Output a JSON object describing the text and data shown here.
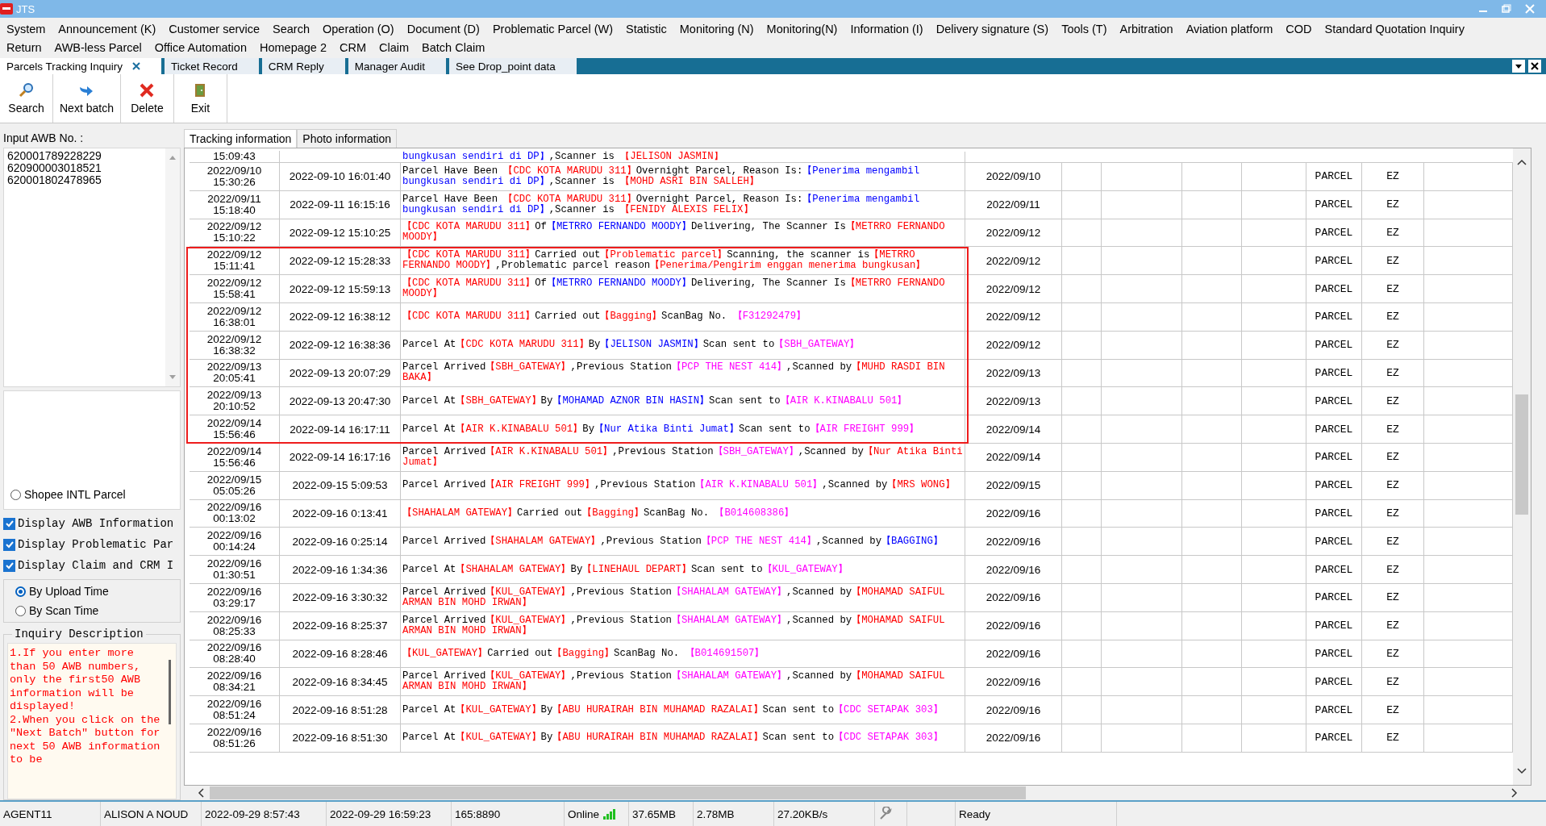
{
  "window": {
    "title": "JTS"
  },
  "menu_rows": [
    [
      "System",
      "Announcement (K)",
      "Customer service",
      "Search",
      "Operation (O)",
      "Document (D)",
      "Problematic Parcel (W)",
      "Statistic",
      "Monitoring (N)",
      "Monitoring(N)",
      "Information (I)",
      "Delivery signature (S)",
      "Tools (T)",
      "Arbitration",
      "Aviation platform",
      "COD",
      "Standard Quotation Inquiry"
    ],
    [
      "Return",
      "AWB-less Parcel",
      "Office Automation",
      "Homepage 2",
      "CRM",
      "Claim",
      "Batch Claim"
    ]
  ],
  "tabs": [
    {
      "label": "Parcels Tracking Inquiry",
      "selected": true,
      "closable": true
    },
    {
      "label": "Ticket Record",
      "selected": false,
      "closable": false
    },
    {
      "label": "CRM Reply",
      "selected": false,
      "closable": false
    },
    {
      "label": "Manager Audit",
      "selected": false,
      "closable": false
    },
    {
      "label": "See Drop_point data",
      "selected": false,
      "closable": false
    }
  ],
  "toolbar": [
    {
      "label": "Search",
      "kind": "search"
    },
    {
      "label": "Next batch",
      "kind": "next"
    },
    {
      "label": "Delete",
      "kind": "delete"
    },
    {
      "label": "Exit",
      "kind": "exit"
    }
  ],
  "awb_input": {
    "label": "Input AWB No. :",
    "lines": [
      "620001789228229",
      "620900003018521",
      "620001802478965"
    ]
  },
  "shopee_option": {
    "label": "Shopee INTL Parcel",
    "selected": false
  },
  "display_options": [
    {
      "label": "Display AWB Information",
      "checked": true
    },
    {
      "label": "Display Problematic Par",
      "checked": true
    },
    {
      "label": "Display Claim and CRM I",
      "checked": true
    }
  ],
  "time_basis": [
    {
      "label": "By Upload Time",
      "selected": true
    },
    {
      "label": "By Scan Time",
      "selected": false
    }
  ],
  "inquiry": {
    "title": "Inquiry Description",
    "paragraphs": [
      "1.If you enter more than  50  AWB numbers, only the first50  AWB information will be displayed!",
      "2.When you click on the ″Next Batch″ button for next  50 AWB information to be"
    ]
  },
  "content_tabs": [
    {
      "label": "Tracking information",
      "selected": true
    },
    {
      "label": "Photo information",
      "selected": false
    }
  ],
  "tracking_rows": [
    {
      "upload_time": "15:09:43",
      "segments": [
        {
          "text": "bungkusan sendiri di DP】",
          "color": "#0000ff"
        },
        {
          "text": ",Scanner is ",
          "color": "#000000"
        },
        {
          "text": "【JELISON JASMIN】",
          "color": "#ff0000"
        }
      ],
      "highlighted": false
    },
    {
      "upload_time": "2022/09/10 15:30:26",
      "scan_time": "2022-09-10 16:01:40",
      "segments": [
        {
          "text": "Parcel Have Been ",
          "color": "#000000"
        },
        {
          "text": "【CDC KOTA MARUDU 311】",
          "color": "#ff0000"
        },
        {
          "text": "Overnight Parcel, Reason Is:",
          "color": "#000000"
        },
        {
          "text": "【Penerima mengambil bungkusan sendiri di DP】",
          "color": "#0000ff"
        },
        {
          "text": ",Scanner is ",
          "color": "#000000"
        },
        {
          "text": "【MOHD ASRI BIN SALLEH】",
          "color": "#ff0000"
        }
      ],
      "date": "2022/09/10",
      "type": "PARCEL",
      "code": "EZ",
      "highlighted": false
    },
    {
      "upload_time": "2022/09/11 15:18:40",
      "scan_time": "2022-09-11 16:15:16",
      "segments": [
        {
          "text": "Parcel Have Been ",
          "color": "#000000"
        },
        {
          "text": "【CDC KOTA MARUDU 311】",
          "color": "#ff0000"
        },
        {
          "text": "Overnight Parcel, Reason Is:",
          "color": "#000000"
        },
        {
          "text": "【Penerima mengambil bungkusan sendiri di DP】",
          "color": "#0000ff"
        },
        {
          "text": ",Scanner is ",
          "color": "#000000"
        },
        {
          "text": "【FENIDY ALEXIS FELIX】",
          "color": "#ff0000"
        }
      ],
      "date": "2022/09/11",
      "type": "PARCEL",
      "code": "EZ",
      "highlighted": false
    },
    {
      "upload_time": "2022/09/12 15:10:22",
      "scan_time": "2022-09-12 15:10:25",
      "segments": [
        {
          "text": "【CDC KOTA MARUDU 311】",
          "color": "#ff0000"
        },
        {
          "text": "Of",
          "color": "#000000"
        },
        {
          "text": "【METRRO FERNANDO MOODY】",
          "color": "#0000ff"
        },
        {
          "text": "Delivering, The Scanner Is",
          "color": "#000000"
        },
        {
          "text": "【METRRO FERNANDO MOODY】",
          "color": "#ff0000"
        }
      ],
      "date": "2022/09/12",
      "type": "PARCEL",
      "code": "EZ",
      "highlighted": false
    },
    {
      "upload_time": "2022/09/12 15:11:41",
      "scan_time": "2022-09-12 15:28:33",
      "segments": [
        {
          "text": "【CDC KOTA MARUDU 311】",
          "color": "#ff0000"
        },
        {
          "text": "Carried out",
          "color": "#000000"
        },
        {
          "text": "【Problematic parcel】",
          "color": "#ff0000"
        },
        {
          "text": "Scanning, the scanner is",
          "color": "#000000"
        },
        {
          "text": "【METRRO FERNANDO MOODY】",
          "color": "#ff0000"
        },
        {
          "text": ",Problematic parcel reason",
          "color": "#000000"
        },
        {
          "text": "【Penerima/Pengirim enggan menerima bungkusan】",
          "color": "#ff0000"
        }
      ],
      "date": "2022/09/12",
      "type": "PARCEL",
      "code": "EZ",
      "highlighted": true
    },
    {
      "upload_time": "2022/09/12 15:58:41",
      "scan_time": "2022-09-12 15:59:13",
      "segments": [
        {
          "text": "【CDC KOTA MARUDU 311】",
          "color": "#ff0000"
        },
        {
          "text": "Of",
          "color": "#000000"
        },
        {
          "text": "【METRRO FERNANDO MOODY】",
          "color": "#0000ff"
        },
        {
          "text": "Delivering, The Scanner Is",
          "color": "#000000"
        },
        {
          "text": "【METRRO FERNANDO MOODY】",
          "color": "#ff0000"
        }
      ],
      "date": "2022/09/12",
      "type": "PARCEL",
      "code": "EZ",
      "highlighted": true
    },
    {
      "upload_time": "2022/09/12 16:38:01",
      "scan_time": "2022-09-12 16:38:12",
      "segments": [
        {
          "text": "【CDC KOTA MARUDU 311】",
          "color": "#ff0000"
        },
        {
          "text": "Carried out",
          "color": "#000000"
        },
        {
          "text": "【Bagging】",
          "color": "#ff0000"
        },
        {
          "text": "ScanBag No. ",
          "color": "#000000"
        },
        {
          "text": "【F31292479】",
          "color": "#ff00ff"
        }
      ],
      "date": "2022/09/12",
      "type": "PARCEL",
      "code": "EZ",
      "highlighted": true
    },
    {
      "upload_time": "2022/09/12 16:38:32",
      "scan_time": "2022-09-12 16:38:36",
      "segments": [
        {
          "text": "Parcel At",
          "color": "#000000"
        },
        {
          "text": "【CDC KOTA MARUDU 311】",
          "color": "#ff0000"
        },
        {
          "text": "By",
          "color": "#000000"
        },
        {
          "text": "【JELISON JASMIN】",
          "color": "#0000ff"
        },
        {
          "text": "Scan sent to",
          "color": "#000000"
        },
        {
          "text": "【SBH_GATEWAY】",
          "color": "#ff00ff"
        }
      ],
      "date": "2022/09/12",
      "type": "PARCEL",
      "code": "EZ",
      "highlighted": true
    },
    {
      "upload_time": "2022/09/13 20:05:41",
      "scan_time": "2022-09-13 20:07:29",
      "segments": [
        {
          "text": "Parcel Arrived",
          "color": "#000000"
        },
        {
          "text": "【SBH_GATEWAY】",
          "color": "#ff0000"
        },
        {
          "text": ",Previous Station",
          "color": "#000000"
        },
        {
          "text": "【PCP THE NEST 414】",
          "color": "#ff00ff"
        },
        {
          "text": ",Scanned by",
          "color": "#000000"
        },
        {
          "text": "【MUHD RASDI BIN BAKA】",
          "color": "#ff0000"
        }
      ],
      "date": "2022/09/13",
      "type": "PARCEL",
      "code": "EZ",
      "highlighted": true
    },
    {
      "upload_time": "2022/09/13 20:10:52",
      "scan_time": "2022-09-13 20:47:30",
      "segments": [
        {
          "text": "Parcel At",
          "color": "#000000"
        },
        {
          "text": "【SBH_GATEWAY】",
          "color": "#ff0000"
        },
        {
          "text": "By",
          "color": "#000000"
        },
        {
          "text": "【MOHAMAD AZNOR BIN HASIN】",
          "color": "#0000ff"
        },
        {
          "text": "Scan sent to",
          "color": "#000000"
        },
        {
          "text": "【AIR K.KINABALU 501】",
          "color": "#ff00ff"
        }
      ],
      "date": "2022/09/13",
      "type": "PARCEL",
      "code": "EZ",
      "highlighted": true
    },
    {
      "upload_time": "2022/09/14 15:56:46",
      "scan_time": "2022-09-14 16:17:11",
      "segments": [
        {
          "text": "Parcel At",
          "color": "#000000"
        },
        {
          "text": "【AIR K.KINABALU 501】",
          "color": "#ff0000"
        },
        {
          "text": "By",
          "color": "#000000"
        },
        {
          "text": "【Nur Atika Binti Jumat】",
          "color": "#0000ff"
        },
        {
          "text": "Scan sent to",
          "color": "#000000"
        },
        {
          "text": "【AIR FREIGHT 999】",
          "color": "#ff00ff"
        }
      ],
      "date": "2022/09/14",
      "type": "PARCEL",
      "code": "EZ",
      "highlighted": true
    },
    {
      "upload_time": "2022/09/14 15:56:46",
      "scan_time": "2022-09-14 16:17:16",
      "segments": [
        {
          "text": "Parcel Arrived",
          "color": "#000000"
        },
        {
          "text": "【AIR K.KINABALU 501】",
          "color": "#ff0000"
        },
        {
          "text": ",Previous Station",
          "color": "#000000"
        },
        {
          "text": "【SBH_GATEWAY】",
          "color": "#ff00ff"
        },
        {
          "text": ",Scanned by",
          "color": "#000000"
        },
        {
          "text": "【Nur Atika Binti Jumat】",
          "color": "#ff0000"
        }
      ],
      "date": "2022/09/14",
      "type": "PARCEL",
      "code": "EZ",
      "highlighted": false
    },
    {
      "upload_time": "2022/09/15 05:05:26",
      "scan_time": "2022-09-15 5:09:53",
      "segments": [
        {
          "text": "Parcel Arrived",
          "color": "#000000"
        },
        {
          "text": "【AIR FREIGHT 999】",
          "color": "#ff0000"
        },
        {
          "text": ",Previous Station",
          "color": "#000000"
        },
        {
          "text": "【AIR K.KINABALU 501】",
          "color": "#ff00ff"
        },
        {
          "text": ",Scanned by",
          "color": "#000000"
        },
        {
          "text": "【MRS WONG】",
          "color": "#ff0000"
        }
      ],
      "date": "2022/09/15",
      "type": "PARCEL",
      "code": "EZ",
      "highlighted": false
    },
    {
      "upload_time": "2022/09/16 00:13:02",
      "scan_time": "2022-09-16 0:13:41",
      "segments": [
        {
          "text": "【SHAHALAM GATEWAY】",
          "color": "#ff0000"
        },
        {
          "text": "Carried out",
          "color": "#000000"
        },
        {
          "text": "【Bagging】",
          "color": "#ff0000"
        },
        {
          "text": "ScanBag No. ",
          "color": "#000000"
        },
        {
          "text": "【B014608386】",
          "color": "#ff00ff"
        }
      ],
      "date": "2022/09/16",
      "type": "PARCEL",
      "code": "EZ",
      "highlighted": false
    },
    {
      "upload_time": "2022/09/16 00:14:24",
      "scan_time": "2022-09-16 0:25:14",
      "segments": [
        {
          "text": "Parcel Arrived",
          "color": "#000000"
        },
        {
          "text": "【SHAHALAM GATEWAY】",
          "color": "#ff0000"
        },
        {
          "text": ",Previous Station",
          "color": "#000000"
        },
        {
          "text": "【PCP THE NEST 414】",
          "color": "#ff00ff"
        },
        {
          "text": ",Scanned by",
          "color": "#000000"
        },
        {
          "text": "【BAGGING】",
          "color": "#0000ff"
        }
      ],
      "date": "2022/09/16",
      "type": "PARCEL",
      "code": "EZ",
      "highlighted": false
    },
    {
      "upload_time": "2022/09/16 01:30:51",
      "scan_time": "2022-09-16 1:34:36",
      "segments": [
        {
          "text": "Parcel At",
          "color": "#000000"
        },
        {
          "text": "【SHAHALAM GATEWAY】",
          "color": "#ff0000"
        },
        {
          "text": "By",
          "color": "#000000"
        },
        {
          "text": "【LINEHAUL DEPART】",
          "color": "#ff0000"
        },
        {
          "text": "Scan sent to",
          "color": "#000000"
        },
        {
          "text": "【KUL_GATEWAY】",
          "color": "#ff00ff"
        }
      ],
      "date": "2022/09/16",
      "type": "PARCEL",
      "code": "EZ",
      "highlighted": false
    },
    {
      "upload_time": "2022/09/16 03:29:17",
      "scan_time": "2022-09-16 3:30:32",
      "segments": [
        {
          "text": "Parcel Arrived",
          "color": "#000000"
        },
        {
          "text": "【KUL_GATEWAY】",
          "color": "#ff0000"
        },
        {
          "text": ",Previous Station",
          "color": "#000000"
        },
        {
          "text": "【SHAHALAM GATEWAY】",
          "color": "#ff00ff"
        },
        {
          "text": ",Scanned by",
          "color": "#000000"
        },
        {
          "text": "【MOHAMAD SAIFUL ARMAN BIN MOHD IRWAN】",
          "color": "#ff0000"
        }
      ],
      "date": "2022/09/16",
      "type": "PARCEL",
      "code": "EZ",
      "highlighted": false
    },
    {
      "upload_time": "2022/09/16 08:25:33",
      "scan_time": "2022-09-16 8:25:37",
      "segments": [
        {
          "text": "Parcel Arrived",
          "color": "#000000"
        },
        {
          "text": "【KUL_GATEWAY】",
          "color": "#ff0000"
        },
        {
          "text": ",Previous Station",
          "color": "#000000"
        },
        {
          "text": "【SHAHALAM GATEWAY】",
          "color": "#ff00ff"
        },
        {
          "text": ",Scanned by",
          "color": "#000000"
        },
        {
          "text": "【MOHAMAD SAIFUL ARMAN BIN MOHD IRWAN】",
          "color": "#ff0000"
        }
      ],
      "date": "2022/09/16",
      "type": "PARCEL",
      "code": "EZ",
      "highlighted": false
    },
    {
      "upload_time": "2022/09/16 08:28:40",
      "scan_time": "2022-09-16 8:28:46",
      "segments": [
        {
          "text": "【KUL_GATEWAY】",
          "color": "#ff0000"
        },
        {
          "text": "Carried out",
          "color": "#000000"
        },
        {
          "text": "【Bagging】",
          "color": "#ff0000"
        },
        {
          "text": "ScanBag No. ",
          "color": "#000000"
        },
        {
          "text": "【B014691507】",
          "color": "#ff00ff"
        }
      ],
      "date": "2022/09/16",
      "type": "PARCEL",
      "code": "EZ",
      "highlighted": false
    },
    {
      "upload_time": "2022/09/16 08:34:21",
      "scan_time": "2022-09-16 8:34:45",
      "segments": [
        {
          "text": "Parcel Arrived",
          "color": "#000000"
        },
        {
          "text": "【KUL_GATEWAY】",
          "color": "#ff0000"
        },
        {
          "text": ",Previous Station",
          "color": "#000000"
        },
        {
          "text": "【SHAHALAM GATEWAY】",
          "color": "#ff00ff"
        },
        {
          "text": ",Scanned by",
          "color": "#000000"
        },
        {
          "text": "【MOHAMAD SAIFUL ARMAN BIN MOHD IRWAN】",
          "color": "#ff0000"
        }
      ],
      "date": "2022/09/16",
      "type": "PARCEL",
      "code": "EZ",
      "highlighted": false
    },
    {
      "upload_time": "2022/09/16 08:51:24",
      "scan_time": "2022-09-16 8:51:28",
      "segments": [
        {
          "text": "Parcel At",
          "color": "#000000"
        },
        {
          "text": "【KUL_GATEWAY】",
          "color": "#ff0000"
        },
        {
          "text": "By",
          "color": "#000000"
        },
        {
          "text": "【ABU HURAIRAH BIN MUHAMAD RAZALAI】",
          "color": "#ff0000"
        },
        {
          "text": "Scan sent to",
          "color": "#000000"
        },
        {
          "text": "【CDC SETAPAK 303】",
          "color": "#ff00ff"
        }
      ],
      "date": "2022/09/16",
      "type": "PARCEL",
      "code": "EZ",
      "highlighted": false
    },
    {
      "upload_time": "2022/09/16 08:51:26",
      "scan_time": "2022-09-16 8:51:30",
      "segments": [
        {
          "text": "Parcel At",
          "color": "#000000"
        },
        {
          "text": "【KUL_GATEWAY】",
          "color": "#ff0000"
        },
        {
          "text": "By",
          "color": "#000000"
        },
        {
          "text": "【ABU HURAIRAH BIN MUHAMAD RAZALAI】",
          "color": "#ff0000"
        },
        {
          "text": "Scan sent to",
          "color": "#000000"
        },
        {
          "text": "【CDC SETAPAK 303】",
          "color": "#ff00ff"
        }
      ],
      "date": "2022/09/16",
      "type": "PARCEL",
      "code": "EZ",
      "highlighted": false
    }
  ],
  "status_bar": [
    {
      "kind": "text",
      "text": "AGENT11"
    },
    {
      "kind": "text",
      "text": "ALISON A NOUD"
    },
    {
      "kind": "text",
      "text": "2022-09-29 8:57:43"
    },
    {
      "kind": "text",
      "text": "2022-09-29 16:59:23"
    },
    {
      "kind": "text",
      "text": "165:8890"
    },
    {
      "kind": "signal",
      "text": "Online"
    },
    {
      "kind": "text",
      "text": "37.65MB"
    },
    {
      "kind": "text",
      "text": "2.78MB"
    },
    {
      "kind": "text",
      "text": "27.20KB/s"
    },
    {
      "kind": "tool"
    },
    {
      "kind": "blank"
    },
    {
      "kind": "text",
      "text": "Ready"
    }
  ]
}
